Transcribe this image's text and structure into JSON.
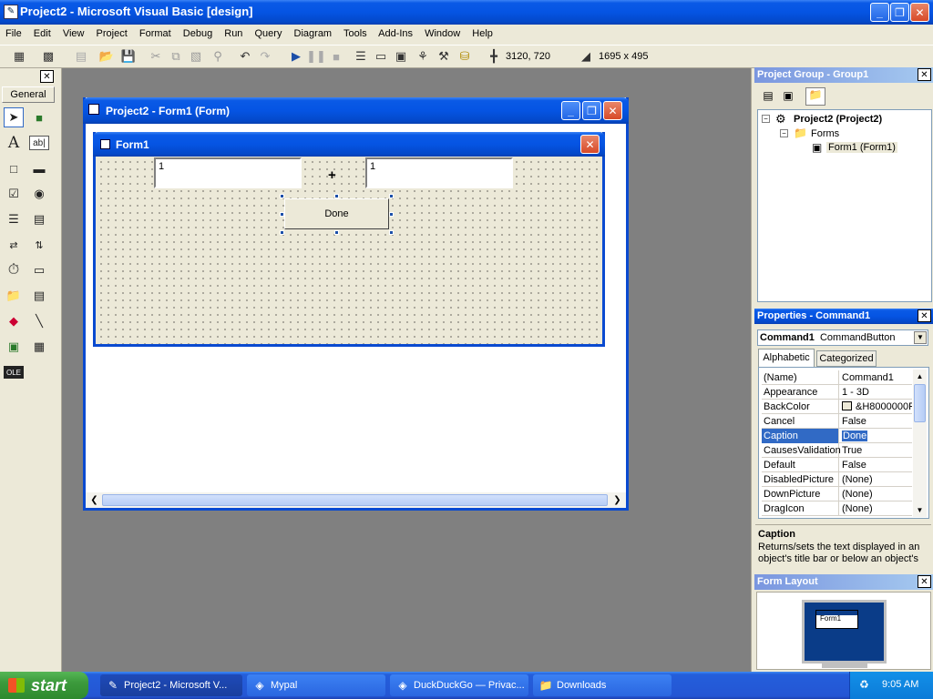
{
  "title_bar": {
    "title": "Project2 - Microsoft Visual Basic [design]"
  },
  "menu": [
    "File",
    "Edit",
    "View",
    "Project",
    "Format",
    "Debug",
    "Run",
    "Query",
    "Diagram",
    "Tools",
    "Add-Ins",
    "Window",
    "Help"
  ],
  "toolbar": {
    "position": "3120, 720",
    "size": "1695 x 495"
  },
  "toolbox": {
    "title": "General"
  },
  "designer": {
    "window_title": "Project2 - Form1 (Form)",
    "form_title": "Form1",
    "text1_value": "1",
    "text2_value": "1",
    "plus_label": "+",
    "button_label": "Done"
  },
  "project_group": {
    "title": "Project Group - Group1",
    "tree": {
      "project": "Project2 (Project2)",
      "folder": "Forms",
      "form": "Form1 (Form1)"
    }
  },
  "properties": {
    "title": "Properties - Command1",
    "object_name": "Command1",
    "object_type": "CommandButton",
    "tabs": [
      "Alphabetic",
      "Categorized"
    ],
    "rows": [
      {
        "name": "(Name)",
        "value": "Command1"
      },
      {
        "name": "Appearance",
        "value": "1 - 3D"
      },
      {
        "name": "BackColor",
        "value": "&H8000000F"
      },
      {
        "name": "Cancel",
        "value": "False"
      },
      {
        "name": "Caption",
        "value": "Done"
      },
      {
        "name": "CausesValidation",
        "value": "True"
      },
      {
        "name": "Default",
        "value": "False"
      },
      {
        "name": "DisabledPicture",
        "value": "(None)"
      },
      {
        "name": "DownPicture",
        "value": "(None)"
      },
      {
        "name": "DragIcon",
        "value": "(None)"
      }
    ],
    "desc_title": "Caption",
    "desc_text": "Returns/sets the text displayed in an object's title bar or below an object's"
  },
  "form_layout": {
    "title": "Form Layout",
    "mini_form": "Form1"
  },
  "taskbar": {
    "start": "start",
    "items": [
      "Project2 - Microsoft V...",
      "Mypal",
      "DuckDuckGo — Privac...",
      "Downloads"
    ],
    "clock": "9:05 AM"
  },
  "colors": {
    "xp_blue": "#0554e3",
    "selection": "#316ac5",
    "start_green": "#3c9a3c"
  }
}
